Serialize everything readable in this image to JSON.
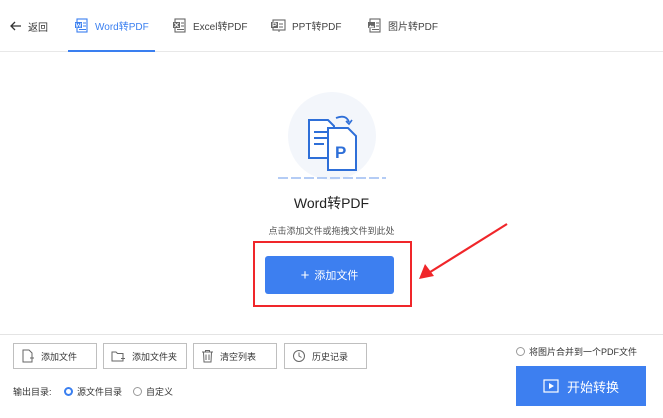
{
  "header": {
    "back_label": "返回",
    "tabs": [
      {
        "label": "Word转PDF",
        "icon": "word-doc-icon",
        "active": true
      },
      {
        "label": "Excel转PDF",
        "icon": "excel-doc-icon",
        "active": false
      },
      {
        "label": "PPT转PDF",
        "icon": "ppt-doc-icon",
        "active": false
      },
      {
        "label": "图片转PDF",
        "icon": "image-doc-icon",
        "active": false
      }
    ]
  },
  "dropzone": {
    "title": "Word转PDF",
    "hint": "点击添加文件或拖拽文件到此处",
    "add_button_label": "添加文件"
  },
  "toolbar": {
    "add_file_label": "添加文件",
    "add_folder_label": "添加文件夹",
    "clear_list_label": "清空列表",
    "history_label": "历史记录"
  },
  "merge_option": {
    "label": "将图片合并到一个PDF文件",
    "checked": false
  },
  "output": {
    "label": "输出目录:",
    "options": [
      {
        "label": "源文件目录",
        "checked": true
      },
      {
        "label": "自定义",
        "checked": false
      }
    ]
  },
  "start_button_label": "开始转换",
  "colors": {
    "accent": "#3d7ff0",
    "annotation_red": "#f0262a"
  }
}
